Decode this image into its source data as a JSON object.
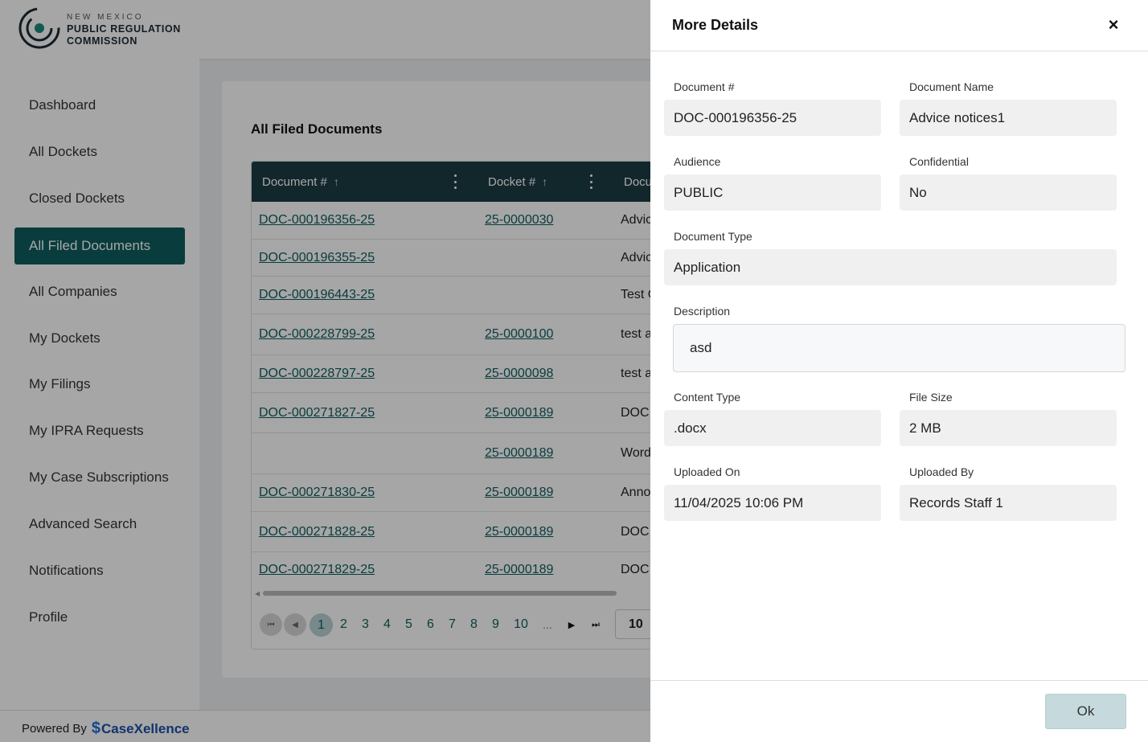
{
  "header": {
    "logo_line1": "NEW MEXICO",
    "logo_line2": "PUBLIC REGULATION",
    "logo_line3": "COMMISSION"
  },
  "sidebar": {
    "items": [
      {
        "label": "Dashboard"
      },
      {
        "label": "All Dockets"
      },
      {
        "label": "Closed Dockets"
      },
      {
        "label": "All Filed Documents",
        "active": true
      },
      {
        "label": "All Companies"
      },
      {
        "label": "My Dockets"
      },
      {
        "label": "My Filings"
      },
      {
        "label": "My IPRA Requests"
      },
      {
        "label": "My Case Subscriptions"
      },
      {
        "label": "Advanced Search"
      },
      {
        "label": "Notifications"
      },
      {
        "label": "Profile"
      }
    ]
  },
  "main": {
    "title": "All Filed Documents",
    "table": {
      "columns": [
        "Document #",
        "Docket #",
        "Docu"
      ],
      "rows": [
        {
          "doc": "DOC-000196356-25",
          "docket": "25-0000030",
          "name": "Advic"
        },
        {
          "doc": "DOC-000196355-25",
          "docket": "",
          "name": "Advic"
        },
        {
          "doc": "DOC-000196443-25",
          "docket": "",
          "name": "Test C"
        },
        {
          "doc": "DOC-000228799-25",
          "docket": "25-0000100",
          "name": "test a"
        },
        {
          "doc": "DOC-000228797-25",
          "docket": "25-0000098",
          "name": "test a"
        },
        {
          "doc": "DOC-000271827-25",
          "docket": "25-0000189",
          "name": "DOC"
        },
        {
          "doc": "",
          "docket": "25-0000189",
          "name": "Word"
        },
        {
          "doc": "DOC-000271830-25",
          "docket": "25-0000189",
          "name": "Anno"
        },
        {
          "doc": "DOC-000271828-25",
          "docket": "25-0000189",
          "name": "DOC"
        },
        {
          "doc": "DOC-000271829-25",
          "docket": "25-0000189",
          "name": "DOC"
        }
      ]
    },
    "pager": {
      "pages": [
        "1",
        "2",
        "3",
        "4",
        "5",
        "6",
        "7",
        "8",
        "9",
        "10"
      ],
      "current": "1",
      "dots": "...",
      "page_size": "10"
    }
  },
  "footer": {
    "powered_by": "Powered By",
    "brand": "CaseXellence"
  },
  "details": {
    "title": "More Details",
    "close_label": "×",
    "document_number_label": "Document #",
    "document_number": "DOC-000196356-25",
    "document_name_label": "Document Name",
    "document_name": "Advice notices1",
    "audience_label": "Audience",
    "audience": "PUBLIC",
    "confidential_label": "Confidential",
    "confidential": "No",
    "document_type_label": "Document Type",
    "document_type": "Application",
    "description_label": "Description",
    "description": "asd",
    "content_type_label": "Content Type",
    "content_type": ".docx",
    "file_size_label": "File Size",
    "file_size": "2 MB",
    "uploaded_on_label": "Uploaded On",
    "uploaded_on": "11/04/2025 10:06 PM",
    "uploaded_by_label": "Uploaded By",
    "uploaded_by": "Records Staff 1",
    "ok_label": "Ok"
  },
  "colors": {
    "accent": "#0e5d5f",
    "table_header": "#1c3d44",
    "ok_button": "#c6dadd"
  }
}
